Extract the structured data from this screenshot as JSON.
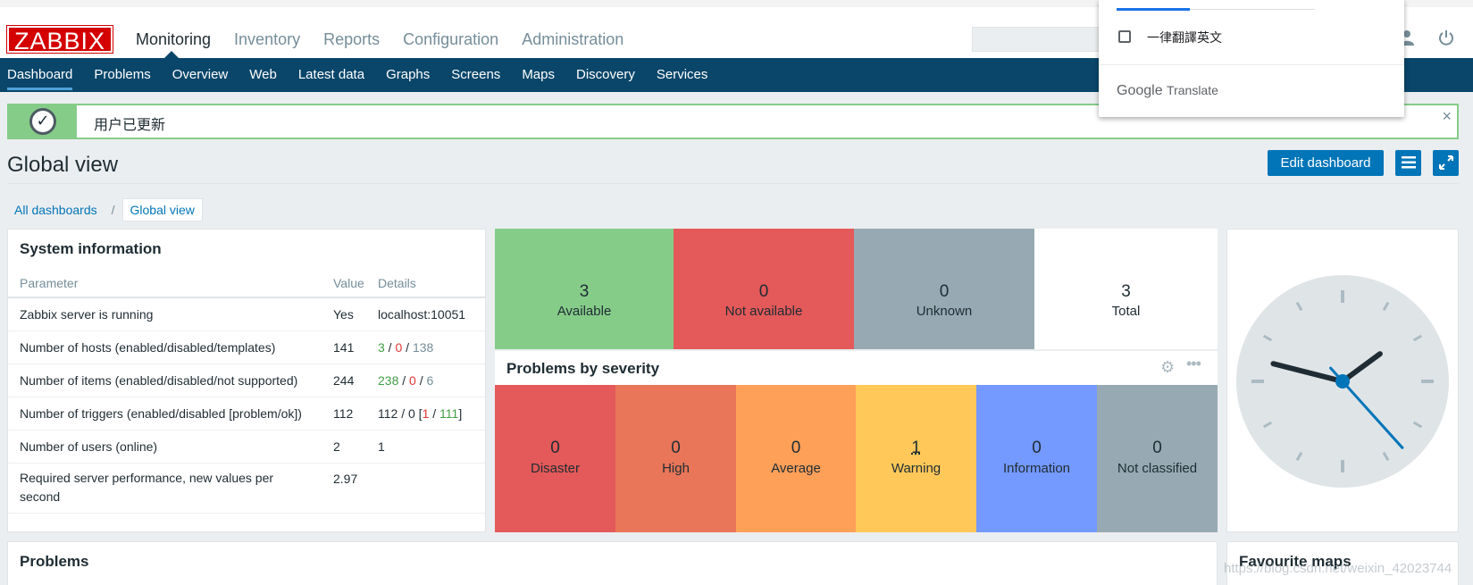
{
  "app": {
    "logo": "ZABBIX"
  },
  "main_menu": [
    {
      "label": "Monitoring",
      "active": true
    },
    {
      "label": "Inventory"
    },
    {
      "label": "Reports"
    },
    {
      "label": "Configuration"
    },
    {
      "label": "Administration"
    }
  ],
  "sub_menu": [
    {
      "label": "Dashboard",
      "active": true
    },
    {
      "label": "Problems"
    },
    {
      "label": "Overview"
    },
    {
      "label": "Web"
    },
    {
      "label": "Latest data"
    },
    {
      "label": "Graphs"
    },
    {
      "label": "Screens"
    },
    {
      "label": "Maps"
    },
    {
      "label": "Discovery"
    },
    {
      "label": "Services"
    }
  ],
  "message": {
    "text": "用户已更新",
    "close": "×"
  },
  "header": {
    "title": "Global view",
    "edit_button": "Edit dashboard"
  },
  "breadcrumb": {
    "parent": "All dashboards",
    "separator": "/",
    "current": "Global view"
  },
  "system_info": {
    "title": "System information",
    "columns": [
      "Parameter",
      "Value",
      "Details"
    ],
    "rows": [
      {
        "param": "Zabbix server is running",
        "value": "Yes",
        "details": "localhost:10051"
      },
      {
        "param": "Number of hosts (enabled/disabled/templates)",
        "value": "141",
        "d1": "3",
        "d2": "0",
        "d3": "138"
      },
      {
        "param": "Number of items (enabled/disabled/not supported)",
        "value": "244",
        "d1": "238",
        "d2": "0",
        "d3": "6"
      },
      {
        "param": "Number of triggers (enabled/disabled [problem/ok])",
        "value": "112",
        "d1": "112 / 0 [",
        "d2": "1",
        "d3": "111",
        "d4": "]"
      },
      {
        "param": "Number of users (online)",
        "value": "2",
        "d1": "1"
      },
      {
        "param": "Required server performance, new values per second",
        "value": "2.97"
      }
    ]
  },
  "host_availability": [
    {
      "count": "3",
      "label": "Available",
      "color": "#86cc89"
    },
    {
      "count": "0",
      "label": "Not available",
      "color": "#e45959"
    },
    {
      "count": "0",
      "label": "Unknown",
      "color": "#97aab3"
    },
    {
      "count": "3",
      "label": "Total",
      "color": "#ffffff"
    }
  ],
  "problems_by_severity": {
    "title": "Problems by severity",
    "items": [
      {
        "count": "0",
        "label": "Disaster",
        "color": "#e45959"
      },
      {
        "count": "0",
        "label": "High",
        "color": "#e97659"
      },
      {
        "count": "0",
        "label": "Average",
        "color": "#ffa059"
      },
      {
        "count": "1",
        "label": "Warning",
        "color": "#ffc859"
      },
      {
        "count": "0",
        "label": "Information",
        "color": "#7499ff"
      },
      {
        "count": "0",
        "label": "Not classified",
        "color": "#97aab3"
      }
    ]
  },
  "clock": {
    "hour": 1,
    "minute": 47,
    "second": 23
  },
  "problems_widget": {
    "title": "Problems"
  },
  "favourite_maps": {
    "title": "Favourite maps"
  },
  "translate_popup": {
    "checkbox_label": "一律翻譯英文",
    "brand_google": "Google",
    "brand_translate": "Translate"
  },
  "watermark": "https://blog.csdn.net/weixin_42023744",
  "icons": [
    "check-icon",
    "close-icon",
    "user-icon",
    "power-icon",
    "menu-icon",
    "fullscreen-icon",
    "gear-icon",
    "more-icon"
  ]
}
